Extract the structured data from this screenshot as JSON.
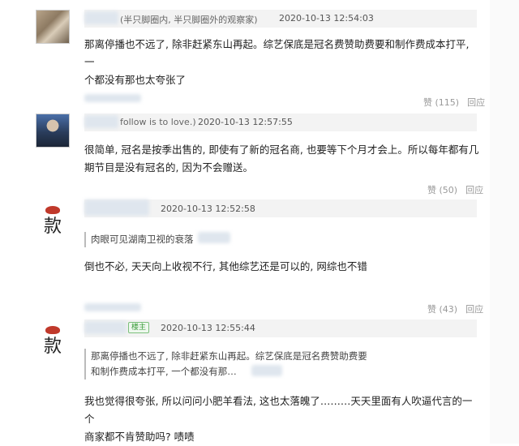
{
  "comments": [
    {
      "user_suffix": "(半只脚圈内, 半只脚圈外的观察家)",
      "time": "2020-10-13 12:54:03",
      "text_line1": "那离停播也不远了, 除非赶紧东山再起。综艺保底是冠名费赞助费要和制作费成本打平, 一",
      "text_line2": "个都没有那也太夸张了",
      "like_label": "赞",
      "like_count": "(115)",
      "reply_label": "回应"
    },
    {
      "user_suffix": "follow is to love.)",
      "time": "2020-10-13 12:57:55",
      "text_line1": "很简单, 冠名是按季出售的, 即使有了新的冠名商, 也要等下个月才会上。所以每年都有几",
      "text_line2": "期节目是没有冠名的, 因为不会赠送。",
      "like_label": "赞",
      "like_count": "(50)",
      "reply_label": "回应"
    },
    {
      "time": "2020-10-13 12:52:58",
      "avatar_text": "款",
      "quote_line1": "肉眼可见湖南卫视的衰落",
      "text_line1": "倒也不必, 天天向上收视不行, 其他综艺还是可以的, 网综也不错",
      "like_label": "赞",
      "like_count": "(43)",
      "reply_label": "回应"
    },
    {
      "time": "2020-10-13 12:55:44",
      "avatar_text": "款",
      "badge": "楼主",
      "quote_line1": "那离停播也不远了, 除非赶紧东山再起。综艺保底是冠名费赞助费要",
      "quote_line2": "和制作费成本打平, 一个都没有那…",
      "text_line1": "我也觉得很夸张, 所以问问小肥羊看法, 这也太落魄了………天天里面有人吹逼代言的一个",
      "text_line2": "商家都不肯赞助吗? 啧啧"
    }
  ]
}
